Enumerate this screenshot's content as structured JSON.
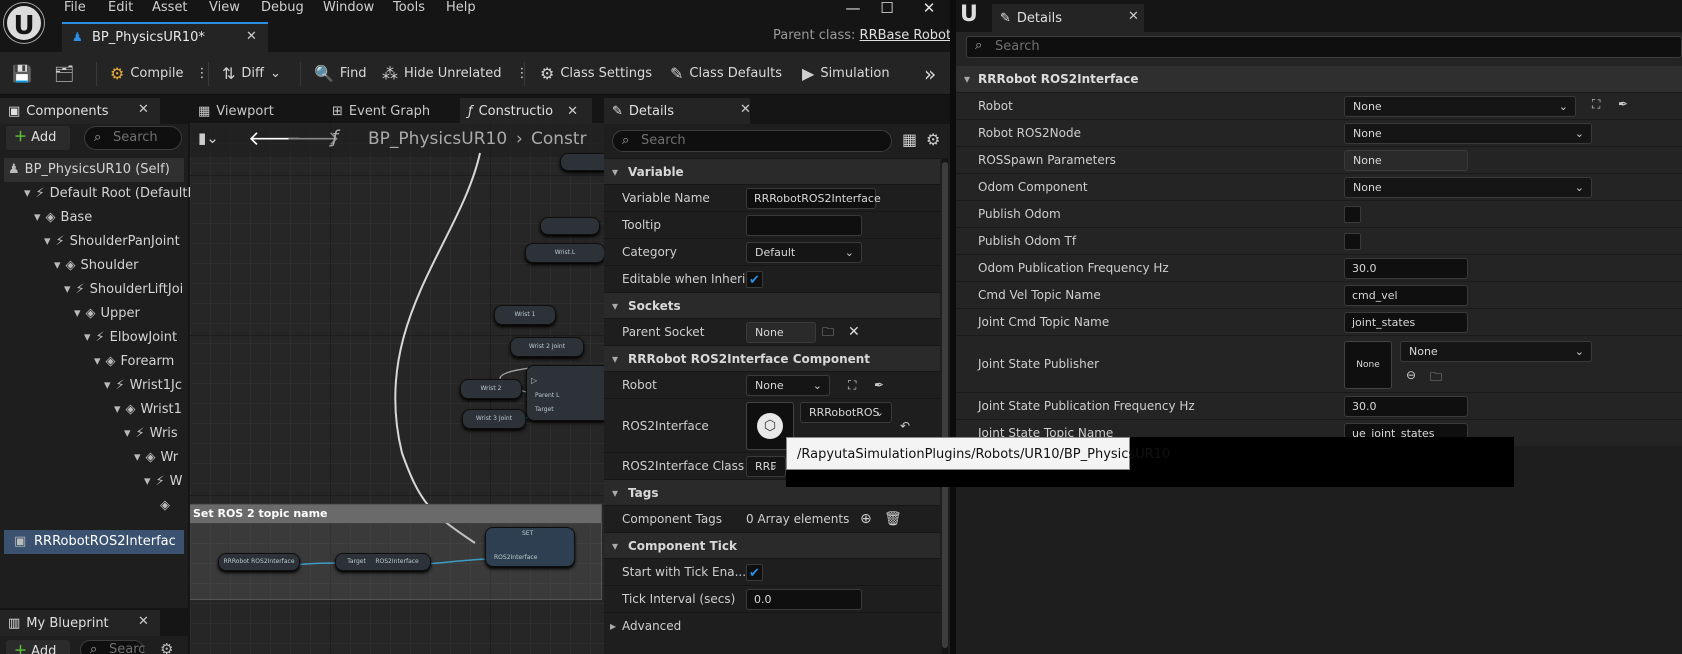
{
  "menu": [
    "File",
    "Edit",
    "Asset",
    "View",
    "Debug",
    "Window",
    "Tools",
    "Help"
  ],
  "doc_tab": "BP_PhysicsUR10*",
  "parent_class_label": "Parent class:",
  "parent_class_value": "RRBase Robot",
  "toolbar": {
    "compile": "Compile",
    "diff": "Diff",
    "find": "Find",
    "hide_unrelated": "Hide Unrelated",
    "class_settings": "Class Settings",
    "class_defaults": "Class Defaults",
    "simulation": "Simulation"
  },
  "components": {
    "title": "Components",
    "add": "Add",
    "search_placeholder": "Search",
    "tree": [
      "BP_PhysicsUR10 (Self)",
      "Default Root (DefaultR",
      "Base",
      "ShoulderPanJoint",
      "Shoulder",
      "ShoulderLiftJoi",
      "Upper",
      "ElbowJoint",
      "Forearm",
      "Wrist1Jc",
      "Wrist1",
      "Wris",
      "Wr",
      "W"
    ],
    "selected": "RRRobotROS2Interfac"
  },
  "my_blueprint": {
    "title": "My Blueprint",
    "add": "Add",
    "search_placeholder": "Searc"
  },
  "graph_tabs": {
    "viewport": "Viewport",
    "event_graph": "Event Graph",
    "construction": "Constructio"
  },
  "graph": {
    "breadcrumb": "BP_PhysicsUR10",
    "breadcrumb2": "Constr",
    "comment": "Set ROS 2 topic name",
    "nodes": {
      "wrist_l": "Wrist.L",
      "wrist1": "Wrist 1",
      "wrist2joint": "Wrist 2 Joint",
      "wrist2": "Wrist 2",
      "wrist3joint": "Wrist 3 Joint",
      "target": "Target",
      "parent": "Parent L",
      "rrobot": "RRRobot ROS2Interface",
      "target2": "Target",
      "ros2if": "ROS2Interface",
      "set": "SET",
      "ros2if2": "ROS2Interface"
    }
  },
  "details": {
    "title": "Details",
    "search_placeholder": "Search",
    "variable": {
      "section": "Variable",
      "name_label": "Variable Name",
      "name_value": "RRRobotROS2Interface",
      "tooltip_label": "Tooltip",
      "category_label": "Category",
      "category_value": "Default",
      "editable_label": "Editable when Inheri..."
    },
    "sockets": {
      "section": "Sockets",
      "parent_socket_label": "Parent Socket",
      "parent_socket_value": "None"
    },
    "component": {
      "section": "RRRobot ROS2Interface Component",
      "robot_label": "Robot",
      "robot_value": "None",
      "ros2_label": "ROS2Interface",
      "ros2_value": "RRRobotROS",
      "ros2class_label": "ROS2Interface Class",
      "ros2class_value": "RRF"
    },
    "tags": {
      "section": "Tags",
      "component_tags_label": "Component Tags",
      "component_tags_value": "0 Array elements"
    },
    "tick": {
      "section": "Component Tick",
      "start_label": "Start with Tick Ena...",
      "interval_label": "Tick Interval (secs)",
      "interval_value": "0.0",
      "advanced": "Advanced"
    }
  },
  "right": {
    "title": "Details",
    "search_placeholder": "Search",
    "section": "RRRobot ROS2Interface",
    "rows": [
      {
        "label": "Robot",
        "value": "None"
      },
      {
        "label": "Robot ROS2Node",
        "value": "None"
      },
      {
        "label": "ROSSpawn Parameters",
        "value": "None"
      },
      {
        "label": "Odom Component",
        "value": "None"
      },
      {
        "label": "Publish Odom",
        "value": ""
      },
      {
        "label": "Publish Odom Tf",
        "value": ""
      },
      {
        "label": "Odom Publication Frequency Hz",
        "value": "30.0"
      },
      {
        "label": "Cmd Vel Topic Name",
        "value": "cmd_vel"
      },
      {
        "label": "Joint Cmd Topic Name",
        "value": "joint_states"
      },
      {
        "label": "Joint State Publisher",
        "value": "None",
        "thumb": "None"
      },
      {
        "label": "Joint State Publication Frequency Hz",
        "value": "30.0"
      },
      {
        "label": "Joint State Topic Name",
        "value": "ue_joint_states"
      }
    ]
  },
  "tooltip": "/RapyutaSimulationPlugins/Robots/UR10/BP_PhysicsUR10"
}
